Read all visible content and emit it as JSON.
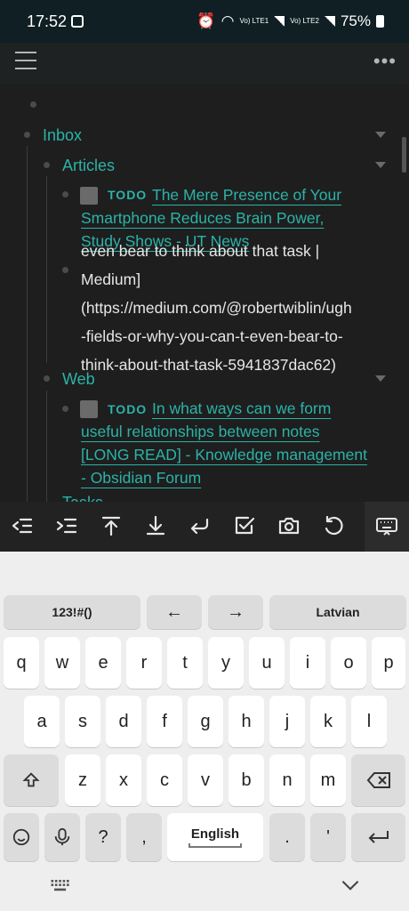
{
  "status": {
    "time": "17:52",
    "net1": "Vo) LTE1",
    "net2": "Vo) LTE2",
    "battery": "75%"
  },
  "outline": {
    "inbox": "Inbox",
    "articles": "Articles",
    "todo_label": "TODO",
    "article_link": [
      "The Mere Presence of Your",
      "Smartphone Reduces Brain Power,",
      "Study Shows - UT News"
    ],
    "editing_text": [
      "even bear to think about that task |",
      "Medium]",
      "(https://medium.com/@robertwiblin/ugh",
      "-fields-or-why-you-can-t-even-bear-to-",
      "think-about-that-task-5941837dac62)"
    ],
    "web": "Web",
    "web_link": [
      "In what ways can we form",
      "useful relationships between notes",
      "[LONG READ] - Knowledge management",
      "- Obsidian Forum"
    ],
    "next_heading": "Tasks"
  },
  "toolbar": {
    "icons": [
      "outdent-icon",
      "indent-icon",
      "move-up-icon",
      "move-down-icon",
      "newline-icon",
      "checkbox-icon",
      "camera-icon",
      "undo-icon",
      "keyboard-icon"
    ]
  },
  "keyboard": {
    "top_row": {
      "symbols": "123!#()",
      "left": "←",
      "right": "→",
      "language": "Latvian"
    },
    "row1": [
      "q",
      "w",
      "e",
      "r",
      "t",
      "y",
      "u",
      "i",
      "o",
      "p"
    ],
    "row2": [
      "a",
      "s",
      "d",
      "f",
      "g",
      "h",
      "j",
      "k",
      "l"
    ],
    "row3": [
      "z",
      "x",
      "c",
      "v",
      "b",
      "n",
      "m"
    ],
    "bottom": {
      "question": "?",
      "comma": ",",
      "space": "English",
      "period": ".",
      "apostrophe": "'"
    }
  }
}
